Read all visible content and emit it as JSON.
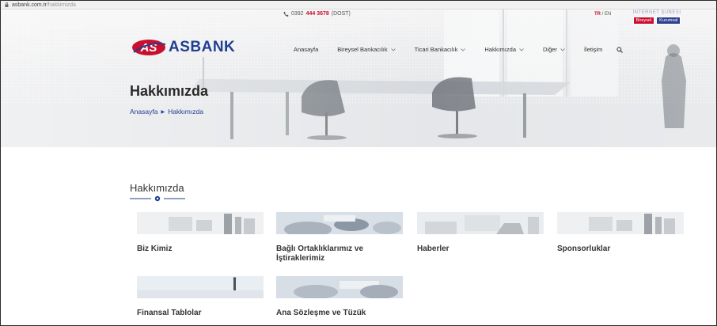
{
  "browser": {
    "url_host": "asbank.com.tr",
    "url_path": "/hakkimizda"
  },
  "topbar": {
    "phone_prefix": "0392",
    "phone_number": "444 3678",
    "phone_suffix": "(DOST)",
    "lang_tr": "TR",
    "lang_sep": " / ",
    "lang_en": "EN",
    "internet_banking_title": "İNTERNET ŞUBESİ",
    "bireysel": "Bireysel",
    "kurumsal": "Kurumsal"
  },
  "logo": {
    "text": "ASBANK"
  },
  "nav": {
    "items": [
      {
        "label": "Anasayfa",
        "dropdown": false
      },
      {
        "label": "Bireysel Bankacılık",
        "dropdown": true
      },
      {
        "label": "Ticari Bankacılık",
        "dropdown": true
      },
      {
        "label": "Hakkımızda",
        "dropdown": true
      },
      {
        "label": "Diğer",
        "dropdown": true
      },
      {
        "label": "İletişim",
        "dropdown": false
      }
    ]
  },
  "hero": {
    "title": "Hakkımızda",
    "breadcrumb_home": "Anasayfa",
    "breadcrumb_current": "Hakkımızda"
  },
  "section": {
    "title": "Hakkımızda"
  },
  "cards": [
    {
      "title": "Biz Kimiz"
    },
    {
      "title": "Bağlı Ortaklıklarımız ve İştiraklerimiz"
    },
    {
      "title": "Haberler"
    },
    {
      "title": "Sponsorluklar"
    },
    {
      "title": "Finansal Tablolar"
    },
    {
      "title": "Ana Sözleşme ve Tüzük"
    }
  ],
  "colors": {
    "brand_blue": "#1f3f92",
    "brand_red": "#c8102e"
  }
}
